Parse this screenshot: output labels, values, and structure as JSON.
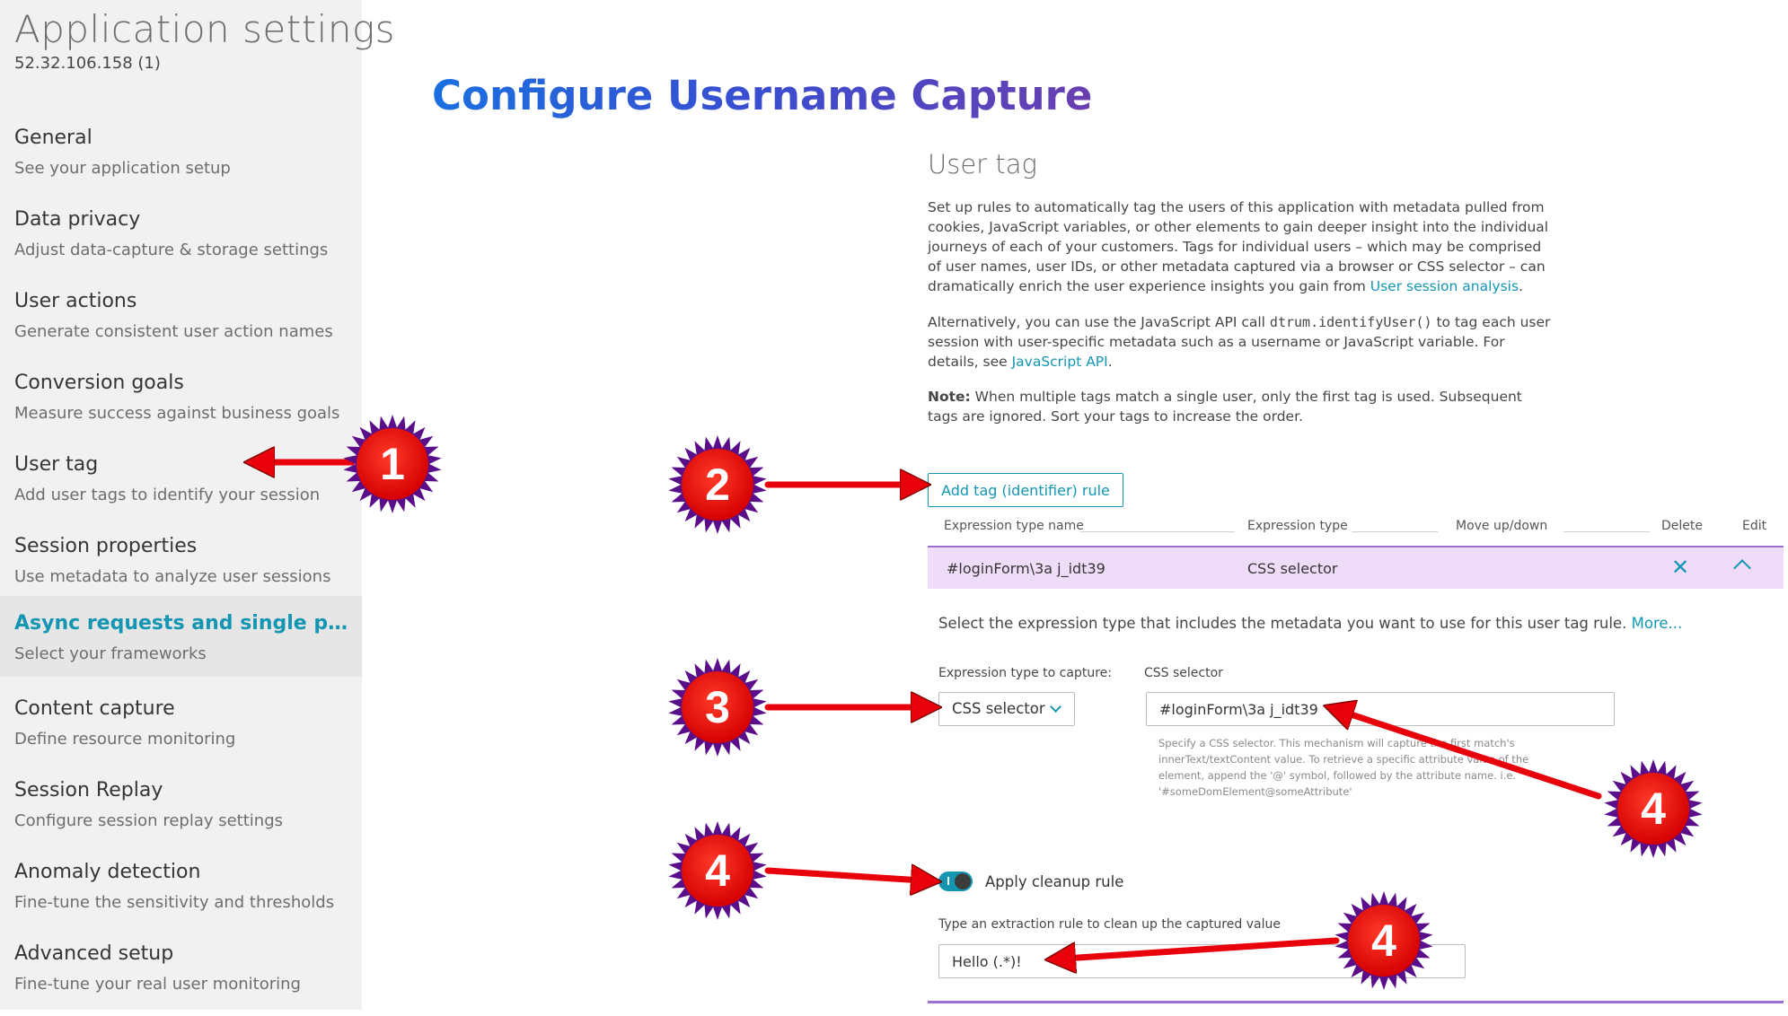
{
  "sidebar": {
    "title": "Application settings",
    "subtitle": "52.32.106.158 (1)",
    "items": [
      {
        "label": "General",
        "desc": "See your application setup"
      },
      {
        "label": "Data privacy",
        "desc": "Adjust data-capture & storage settings"
      },
      {
        "label": "User actions",
        "desc": "Generate consistent user action names"
      },
      {
        "label": "Conversion goals",
        "desc": "Measure success against business goals"
      },
      {
        "label": "User tag",
        "desc": "Add user tags to identify your session"
      },
      {
        "label": "Session properties",
        "desc": "Use metadata to analyze user sessions"
      },
      {
        "label": "Async requests and single page a...",
        "desc": "Select your frameworks",
        "active": true
      },
      {
        "label": "Content capture",
        "desc": "Define resource monitoring"
      },
      {
        "label": "Session Replay",
        "desc": "Configure session replay settings"
      },
      {
        "label": "Anomaly detection",
        "desc": "Fine-tune the sensitivity and thresholds"
      },
      {
        "label": "Advanced setup",
        "desc": "Fine-tune your real user monitoring"
      }
    ]
  },
  "headline": "Configure Username Capture",
  "main": {
    "section_title": "User tag",
    "p1": {
      "text": "Set up rules to automatically tag the users of this application with metadata pulled from cookies, JavaScript variables, or other elements to gain deeper insight into the individual journeys of each of your customers. Tags for individual users – which may be comprised of user names, user IDs, or other metadata captured via a browser or CSS selector – can dramatically enrich the user experience insights you gain from ",
      "link": "User session analysis",
      "end": "."
    },
    "p2": {
      "pre": "Alternatively, you can use the JavaScript API call ",
      "code": "dtrum.identifyUser()",
      "mid": " to tag each user session with user-specific metadata such as a username or JavaScript variable. For details, see ",
      "link": "JavaScript API",
      "end": "."
    },
    "note": {
      "label": "Note:",
      "text": " When multiple tags match a single user, only the first tag is used. Subsequent tags are ignored. Sort your tags to increase the order."
    },
    "add_button": "Add tag (identifier) rule",
    "table": {
      "headers": [
        "Expression type name",
        "Expression type",
        "Move up/down",
        "Delete",
        "Edit"
      ],
      "rows": [
        {
          "name": "#loginForm\\3a j_idt39",
          "type": "CSS selector"
        }
      ]
    },
    "detail": {
      "helper_text": "Select the expression type that includes the metadata you want to use for this user tag rule. ",
      "helper_link": "More...",
      "expr_label": "Expression type to capture:",
      "expr_value": "CSS selector",
      "css_label": "CSS selector",
      "css_value": "#loginForm\\3a j_idt39",
      "css_hint": "Specify a CSS selector. This mechanism will capture the first match's innerText/textContent value. To retrieve a specific attribute value of the element, append the '@' symbol, followed by the attribute name. i.e. '#someDomElement@someAttribute'",
      "toggle_label": "Apply cleanup rule",
      "toggle_on": true,
      "extract_label": "Type an extraction rule to clean up the captured value",
      "extract_value": "Hello (.*)!"
    }
  },
  "annotations": {
    "badges": [
      "1",
      "2",
      "3",
      "4",
      "4",
      "4"
    ],
    "badge_color": "#d40000",
    "badge_outline": "#5a0e8a",
    "arrow_color": "#e8000b"
  }
}
